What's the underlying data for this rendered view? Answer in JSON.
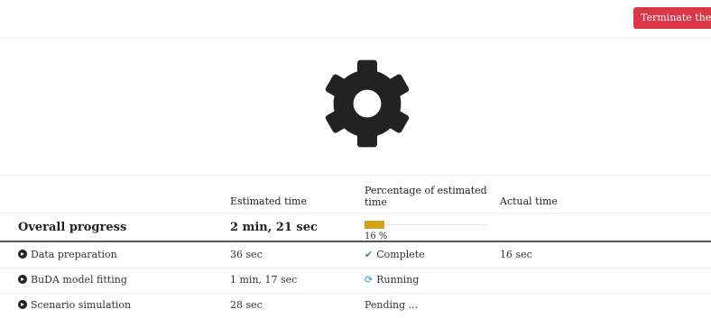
{
  "header": {
    "terminate_label": "Terminate the job"
  },
  "status_icon": "gear-icon",
  "table": {
    "headers": {
      "name": "",
      "estimated": "Estimated time",
      "percentage_line1": "Percentage of estimated",
      "percentage_line2": "time",
      "actual": "Actual time"
    },
    "overall": {
      "label": "Overall progress",
      "estimated": "2 min, 21 sec",
      "percent_value": 16,
      "percent_text": "16 %",
      "bar_color": "#d4a21a"
    },
    "rows": [
      {
        "name": "Data preparation",
        "estimated": "36 sec",
        "status_icon": "check-icon",
        "status": "Complete",
        "actual": "16 sec"
      },
      {
        "name": "BuDA model fitting",
        "estimated": "1 min, 17 sec",
        "status_icon": "spinner-icon",
        "status": "Running",
        "actual": ""
      },
      {
        "name": "Scenario simulation",
        "estimated": "28 sec",
        "status_icon": "",
        "status": "Pending ...",
        "actual": ""
      }
    ]
  },
  "colors": {
    "terminate": "#dc3545",
    "complete": "#2e9e3e",
    "running": "#2a8fd8"
  }
}
